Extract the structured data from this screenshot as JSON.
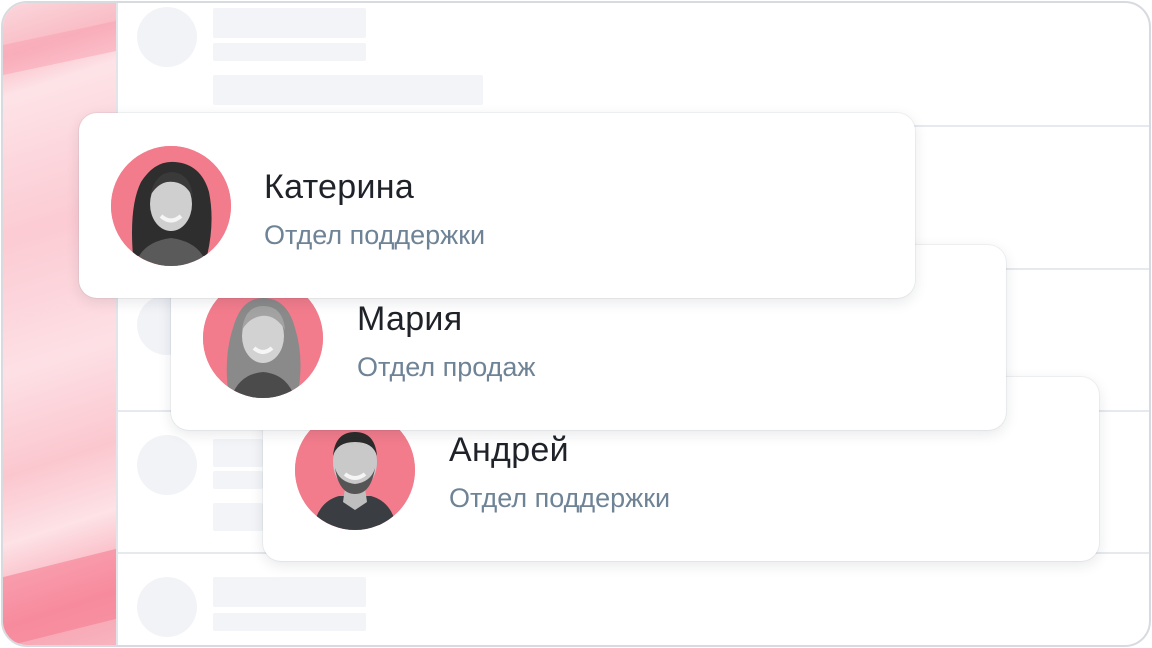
{
  "contacts": [
    {
      "name": "Катерина",
      "department": "Отдел поддержки"
    },
    {
      "name": "Мария",
      "department": "Отдел продаж"
    },
    {
      "name": "Андрей",
      "department": "Отдел поддержки"
    }
  ],
  "colors": {
    "accent": "#f27c8c",
    "name_text": "#1f2329",
    "department_text": "#6f8396",
    "skeleton": "#f2f4f8",
    "border": "#d7dadf"
  },
  "icons": [
    "avatar-photo-icon"
  ]
}
